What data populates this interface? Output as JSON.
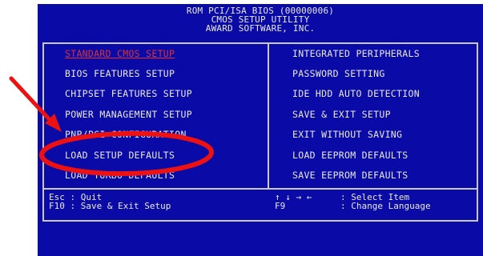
{
  "header": {
    "line1": "ROM PCI/ISA BIOS (00000006)",
    "line2": "CMOS SETUP UTILITY",
    "line3": "AWARD SOFTWARE, INC."
  },
  "menu": {
    "left": [
      {
        "label": "STANDARD CMOS SETUP",
        "selected": true
      },
      {
        "label": "BIOS FEATURES SETUP"
      },
      {
        "label": "CHIPSET FEATURES SETUP"
      },
      {
        "label": "POWER MANAGEMENT SETUP"
      },
      {
        "label": "PNP/PCI CONFIGURATION"
      },
      {
        "label": "LOAD SETUP DEFAULTS"
      },
      {
        "label": "LOAD TURBO DEFAULTS"
      }
    ],
    "right": [
      {
        "label": "INTEGRATED PERIPHERALS"
      },
      {
        "label": "PASSWORD SETTING"
      },
      {
        "label": "IDE HDD AUTO DETECTION"
      },
      {
        "label": "SAVE & EXIT SETUP"
      },
      {
        "label": "EXIT WITHOUT SAVING"
      },
      {
        "label": "LOAD EEPROM DEFAULTS"
      },
      {
        "label": "SAVE EEPROM DEFAULTS"
      }
    ]
  },
  "help": {
    "esc_key": "Esc : Quit",
    "f10_key": "F10 : Save & Exit Setup",
    "arrows": "↑ ↓ → ←",
    "arrows_desc": ": Select Item",
    "f9_key": "F9",
    "f9_desc": ": Change Language"
  },
  "colors": {
    "bios_background": "#0a0aa6",
    "text": "#e8e8e8",
    "selected_text": "#e03030",
    "annotation": "#ee1111"
  },
  "annotation": {
    "arrow_icon": "red-arrow-icon",
    "highlight_icon": "red-ellipse-icon"
  }
}
